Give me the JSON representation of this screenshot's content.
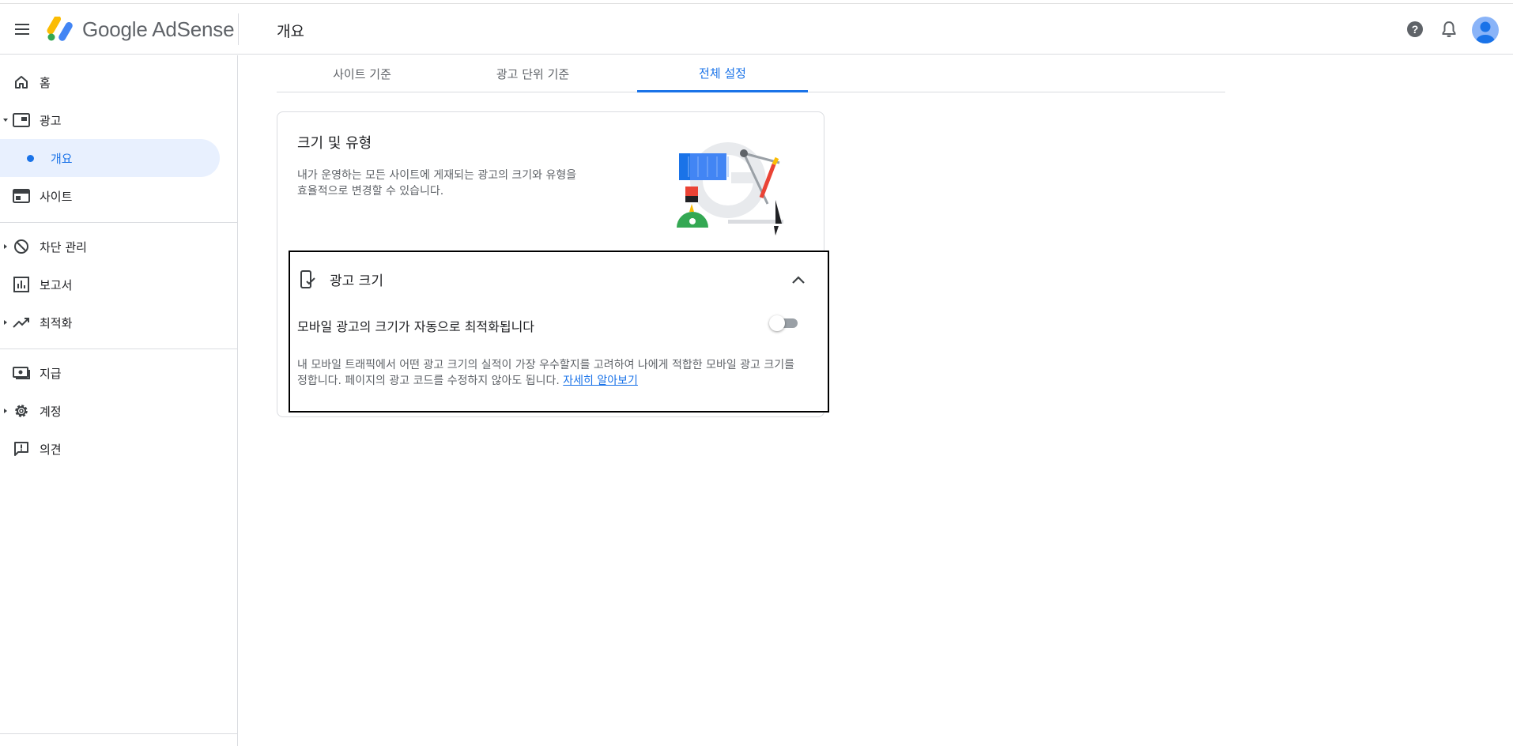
{
  "app": {
    "logo_text": "Google AdSense",
    "page_title": "개요"
  },
  "header": {
    "icons": [
      "help-icon",
      "notifications-icon",
      "account-avatar"
    ]
  },
  "sidebar": {
    "items": [
      {
        "label": "홈",
        "icon": "home-icon"
      },
      {
        "label": "광고",
        "icon": "ads-icon"
      },
      {
        "label": "개요",
        "icon": "dot"
      },
      {
        "label": "사이트",
        "icon": "sites-icon"
      },
      {
        "label": "차단 관리",
        "icon": "block-icon"
      },
      {
        "label": "보고서",
        "icon": "reports-icon"
      },
      {
        "label": "최적화",
        "icon": "trending-icon"
      },
      {
        "label": "지급",
        "icon": "payments-icon"
      },
      {
        "label": "계정",
        "icon": "settings-icon"
      },
      {
        "label": "의견",
        "icon": "feedback-icon"
      }
    ]
  },
  "tabs": [
    {
      "label": "사이트 기준"
    },
    {
      "label": "광고 단위 기준"
    },
    {
      "label": "전체 설정"
    }
  ],
  "card": {
    "title": "크기 및 유형",
    "description": "내가 운영하는 모든 사이트에 게재되는 광고의 크기와 유형을 효율적으로 변경할 수 있습니다."
  },
  "ad_size_panel": {
    "title": "광고 크기",
    "option_label": "모바일 광고의 크기가 자동으로 최적화됩니다",
    "toggle_state": "off",
    "description": "내 모바일 트래픽에서 어떤 광고 크기의 실적이 가장 우수할지를 고려하여 나에게 적합한 모바일 광고 크기를 정합니다. 페이지의 광고 코드를 수정하지 않아도 됩니다.",
    "link": "자세히 알아보기"
  },
  "colors": {
    "accent": "#1a73e8",
    "active_bg": "#e8f0fe"
  }
}
